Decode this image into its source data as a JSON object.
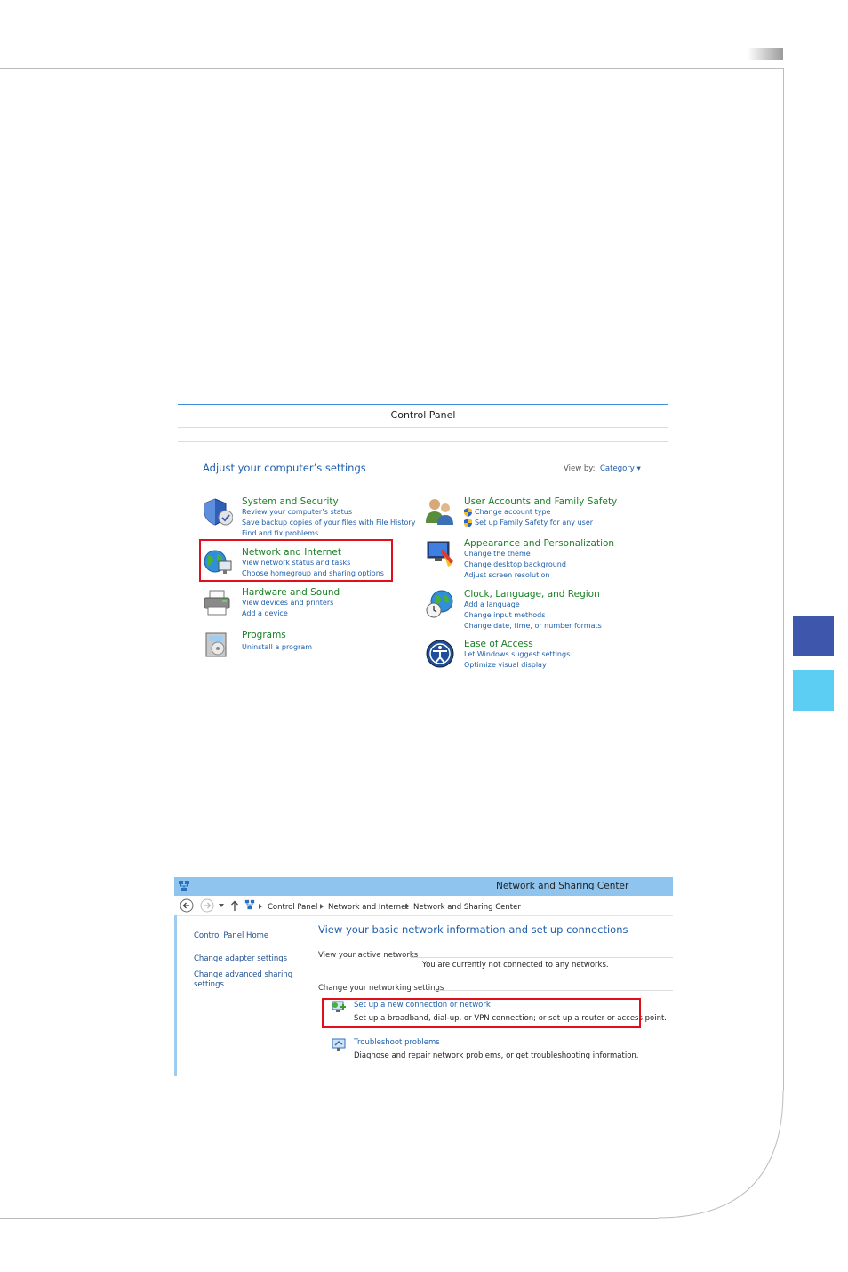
{
  "control_panel": {
    "window_title": "Control Panel",
    "heading": "Adjust your computer’s settings",
    "view_by_label": "View by:",
    "view_by_value": "Category ▾",
    "categories": [
      {
        "title": "System and Security",
        "links": [
          "Review your computer’s status",
          "Save backup copies of your files with File History",
          "Find and fix problems"
        ]
      },
      {
        "title": "Network and Internet",
        "links": [
          "View network status and tasks",
          "Choose homegroup and sharing options"
        ]
      },
      {
        "title": "Hardware and Sound",
        "links": [
          "View devices and printers",
          "Add a device"
        ]
      },
      {
        "title": "Programs",
        "links": [
          "Uninstall a program"
        ]
      },
      {
        "title": "User Accounts and Family Safety",
        "links": [
          "Change account type",
          "Set up Family Safety for any user"
        ]
      },
      {
        "title": "Appearance and Personalization",
        "links": [
          "Change the theme",
          "Change desktop background",
          "Adjust screen resolution"
        ]
      },
      {
        "title": "Clock, Language, and Region",
        "links": [
          "Add a language",
          "Change input methods",
          "Change date, time, or number formats"
        ]
      },
      {
        "title": "Ease of Access",
        "links": [
          "Let Windows suggest settings",
          "Optimize visual display"
        ]
      }
    ]
  },
  "network_center": {
    "window_title": "Network and Sharing Center",
    "breadcrumbs": [
      "Control Panel",
      "Network and Internet",
      "Network and Sharing Center"
    ],
    "sidebar": [
      "Control Panel Home",
      "Change adapter settings",
      "Change advanced sharing",
      "settings"
    ],
    "heading": "View your basic network information and set up connections",
    "active_networks_label": "View your active networks",
    "active_networks_status": "You are currently not connected to any networks.",
    "change_settings_label": "Change your networking settings",
    "tasks": [
      {
        "link": "Set up a new connection or network",
        "desc": "Set up a broadband, dial-up, or VPN connection; or set up a router or access point."
      },
      {
        "link": "Troubleshoot problems",
        "desc": "Diagnose and repair network problems, or get troubleshooting information."
      }
    ]
  },
  "colors": {
    "highlight": "#e0101a",
    "link": "#1e5eab",
    "category": "#1a8024",
    "side_dark": "#3f56ad",
    "side_light": "#5ccdf3"
  }
}
